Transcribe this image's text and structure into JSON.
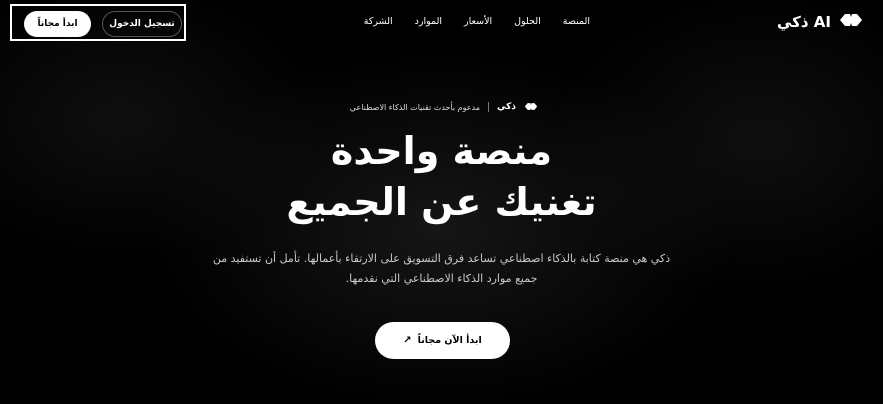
{
  "header": {
    "brand_name": "ذكي AI",
    "logo_icon": "double-diamond-logo",
    "nav": [
      {
        "label": "المنصة"
      },
      {
        "label": "الحلول"
      },
      {
        "label": "الأسعار"
      },
      {
        "label": "الموارد"
      },
      {
        "label": "الشركة"
      }
    ],
    "login_label": "تسجيل الدخول",
    "start_free_label": "ابدأ مجاناً"
  },
  "hero": {
    "badge_brand": "ذكي",
    "badge_text": "مدعوم بأحدث تقنيات الذكاء الاصطناعي",
    "title_line1": "منصة واحدة",
    "title_line2": "تغنيك عن الجميع",
    "desc_line1": "ذكي هي منصة كتابة بالذكاء اصطناعي تساعد فرق التسويق على الارتقاء بأعمالها. تأمل أن تستفيد من",
    "desc_line2": "جميع موارد الذكاء الاصطناعي التي نقدمها.",
    "cta_label": "ابدأ الآن مجاناً",
    "cta_icon": "arrow-up-left-icon"
  },
  "colors": {
    "background": "#000000",
    "text": "#ffffff",
    "button_bg": "#ffffff",
    "button_text": "#000000"
  }
}
